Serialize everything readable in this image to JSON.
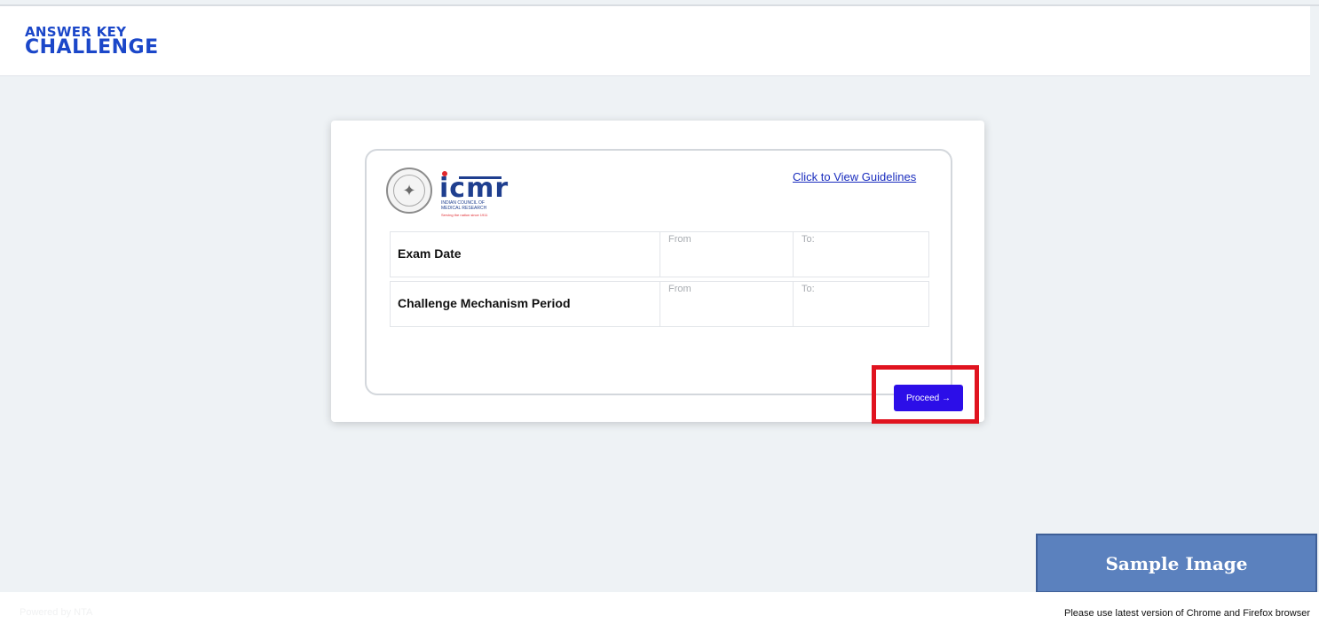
{
  "header": {
    "brand_line1": "ANSWER KEY",
    "brand_line2": "CHALLENGE"
  },
  "card": {
    "logo_text": "icmr",
    "logo_sub": "INDIAN COUNCIL OF MEDICAL RESEARCH",
    "logo_tagline": "Serving the nation since 1911",
    "guidelines_link": "Click to View Guidelines",
    "rows": [
      {
        "label": "Exam Date",
        "from_placeholder": "From",
        "to_placeholder": "To:"
      },
      {
        "label": "Challenge Mechanism Period",
        "from_placeholder": "From",
        "to_placeholder": "To:"
      }
    ],
    "proceed_label": "Proceed →"
  },
  "footer": {
    "left_text": "Powered by NTA",
    "right_text": "Please use latest version of Chrome and Firefox browser"
  },
  "watermark": "Sample Image",
  "colors": {
    "brand": "#1b47c9",
    "button": "#2c0ee8",
    "highlight": "#e0131f",
    "watermark_bg": "#5b81be"
  }
}
